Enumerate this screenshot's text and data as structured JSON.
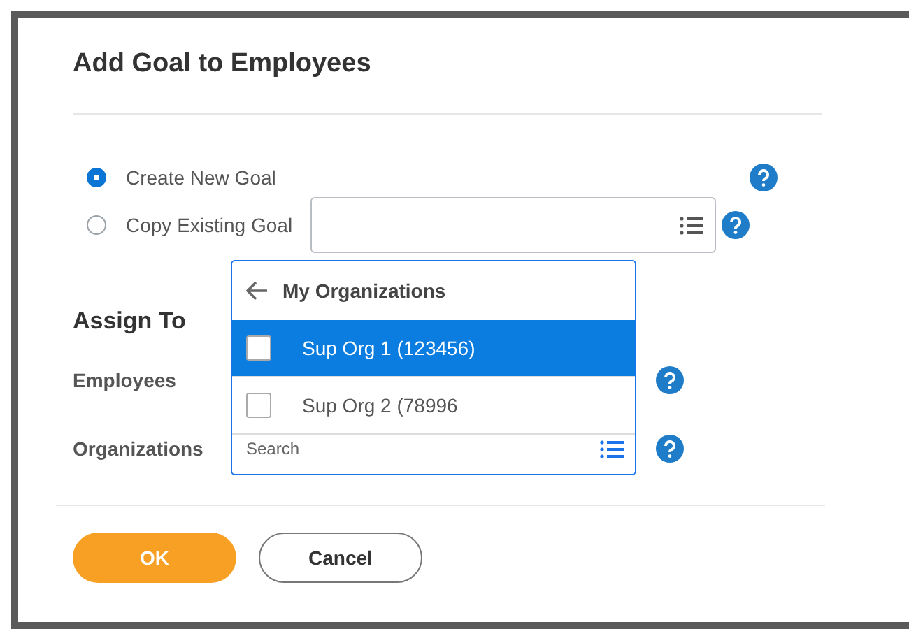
{
  "dialog": {
    "title": "Add Goal to Employees"
  },
  "goal_options": [
    {
      "label": "Create New Goal",
      "selected": true
    },
    {
      "label": "Copy Existing Goal",
      "selected": false
    }
  ],
  "assign_to": {
    "heading": "Assign To",
    "fields": [
      {
        "label": "Employees",
        "kind": "plain"
      },
      {
        "label": "Organizations",
        "kind": "search",
        "placeholder": "Search"
      }
    ]
  },
  "dropdown": {
    "title": "My Organizations",
    "items": [
      {
        "label": "Sup Org 1 (123456)",
        "selected": true,
        "checked": false
      },
      {
        "label": "Sup Org 2 (78996",
        "selected": false,
        "checked": false
      }
    ]
  },
  "buttons": [
    {
      "label": "OK",
      "kind": "primary"
    },
    {
      "label": "Cancel",
      "kind": "secondary"
    }
  ]
}
